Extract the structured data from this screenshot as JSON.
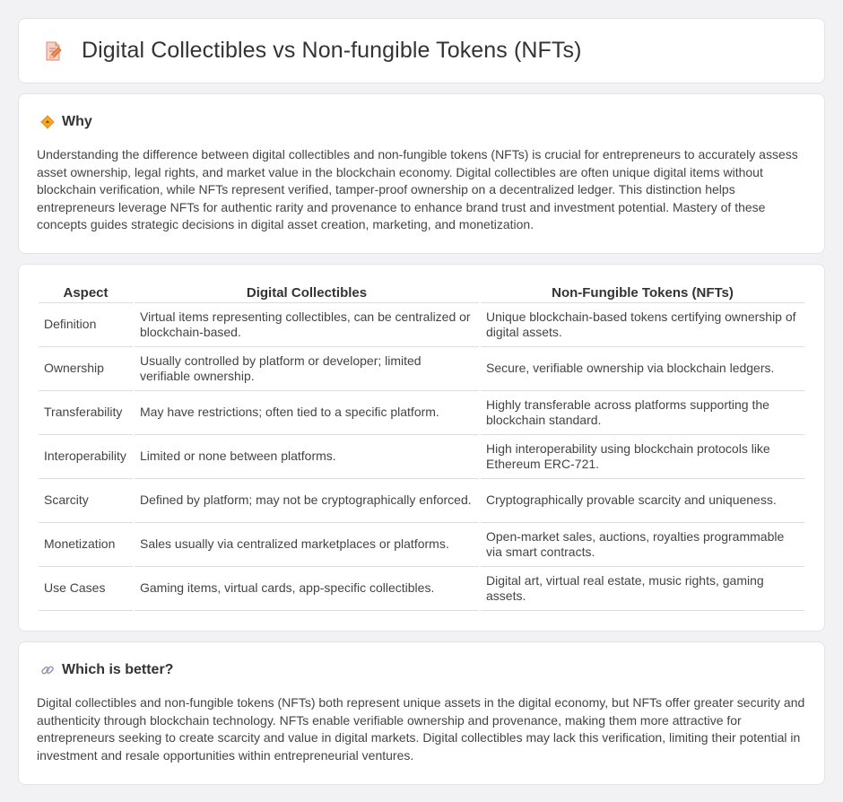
{
  "header": {
    "title": "Digital Collectibles vs Non-fungible Tokens (NFTs)",
    "icon": "document-pencil-icon"
  },
  "why": {
    "heading": "Why",
    "icon": "diamond-sign-icon",
    "text": "Understanding the difference between digital collectibles and non-fungible tokens (NFTs) is crucial for entrepreneurs to accurately assess asset ownership, legal rights, and market value in the blockchain economy. Digital collectibles are often unique digital items without blockchain verification, while NFTs represent verified, tamper-proof ownership on a decentralized ledger. This distinction helps entrepreneurs leverage NFTs for authentic rarity and provenance to enhance brand trust and investment potential. Mastery of these concepts guides strategic decisions in digital asset creation, marketing, and monetization."
  },
  "table": {
    "headers": [
      "Aspect",
      "Digital Collectibles",
      "Non-Fungible Tokens (NFTs)"
    ],
    "rows": [
      [
        "Definition",
        "Virtual items representing collectibles, can be centralized or blockchain-based.",
        "Unique blockchain-based tokens certifying ownership of digital assets."
      ],
      [
        "Ownership",
        "Usually controlled by platform or developer; limited verifiable ownership.",
        "Secure, verifiable ownership via blockchain ledgers."
      ],
      [
        "Transferability",
        "May have restrictions; often tied to a specific platform.",
        "Highly transferable across platforms supporting the blockchain standard."
      ],
      [
        "Interoperability",
        "Limited or none between platforms.",
        "High interoperability using blockchain protocols like Ethereum ERC-721."
      ],
      [
        "Scarcity",
        "Defined by platform; may not be cryptographically enforced.",
        "Cryptographically provable scarcity and uniqueness."
      ],
      [
        "Monetization",
        "Sales usually via centralized marketplaces or platforms.",
        "Open-market sales, auctions, royalties programmable via smart contracts."
      ],
      [
        "Use Cases",
        "Gaming items, virtual cards, app-specific collectibles.",
        "Digital art, virtual real estate, music rights, gaming assets."
      ]
    ]
  },
  "better": {
    "heading": "Which is better?",
    "icon": "link-icon",
    "text": "Digital collectibles and non-fungible tokens (NFTs) both represent unique assets in the digital economy, but NFTs offer greater security and authenticity through blockchain technology. NFTs enable verifiable ownership and provenance, making them more attractive for entrepreneurs seeking to create scarcity and value in digital markets. Digital collectibles may lack this verification, limiting their potential in investment and resale opportunities within entrepreneurial ventures."
  }
}
